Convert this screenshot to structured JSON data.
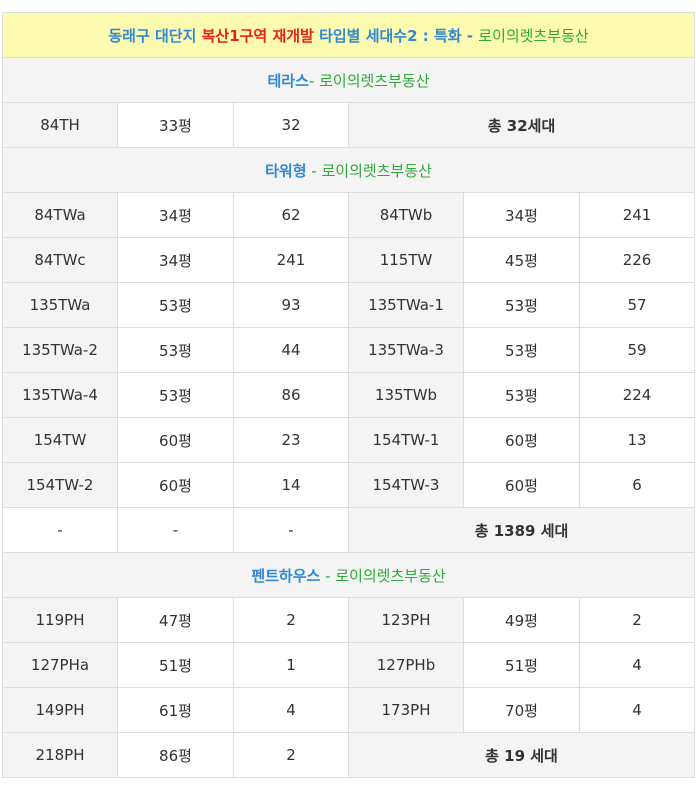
{
  "title": {
    "part1": "동래구 대단지 ",
    "part2": "복산1구역 재개발",
    "part3": " 타입별 세대수2 : 특화 - ",
    "part4": "로이의렛츠부동산"
  },
  "sections": {
    "terrace": {
      "name": "테라스",
      "sep": "- ",
      "brand": "로이의렛츠부동산"
    },
    "tower": {
      "name": "타워형",
      "sep": " - ",
      "brand": "로이의렛츠부동산"
    },
    "penthouse": {
      "name": "펜트하우스",
      "sep": " - ",
      "brand": "로이의렛츠부동산"
    }
  },
  "terrace_row": {
    "type": "84TH",
    "pyeong": "33평",
    "count": "32",
    "total": "총 32세대"
  },
  "tower_rows": [
    [
      {
        "type": "84TWa",
        "pyeong": "34평",
        "count": "62"
      },
      {
        "type": "84TWb",
        "pyeong": "34평",
        "count": "241"
      }
    ],
    [
      {
        "type": "84TWc",
        "pyeong": "34평",
        "count": "241"
      },
      {
        "type": "115TW",
        "pyeong": "45평",
        "count": "226"
      }
    ],
    [
      {
        "type": "135TWa",
        "pyeong": "53평",
        "count": "93"
      },
      {
        "type": "135TWa-1",
        "pyeong": "53평",
        "count": "57"
      }
    ],
    [
      {
        "type": "135TWa-2",
        "pyeong": "53평",
        "count": "44"
      },
      {
        "type": "135TWa-3",
        "pyeong": "53평",
        "count": "59"
      }
    ],
    [
      {
        "type": "135TWa-4",
        "pyeong": "53평",
        "count": "86"
      },
      {
        "type": "135TWb",
        "pyeong": "53평",
        "count": "224"
      }
    ],
    [
      {
        "type": "154TW",
        "pyeong": "60평",
        "count": "23"
      },
      {
        "type": "154TW-1",
        "pyeong": "60평",
        "count": "13"
      }
    ],
    [
      {
        "type": "154TW-2",
        "pyeong": "60평",
        "count": "14"
      },
      {
        "type": "154TW-3",
        "pyeong": "60평",
        "count": "6"
      }
    ]
  ],
  "tower_total": {
    "dash": "-",
    "total": "총 1389 세대"
  },
  "ph_rows": [
    [
      {
        "type": "119PH",
        "pyeong": "47평",
        "count": "2"
      },
      {
        "type": "123PH",
        "pyeong": "49평",
        "count": "2"
      }
    ],
    [
      {
        "type": "127PHa",
        "pyeong": "51평",
        "count": "1"
      },
      {
        "type": "127PHb",
        "pyeong": "51평",
        "count": "4"
      }
    ],
    [
      {
        "type": "149PH",
        "pyeong": "61평",
        "count": "4"
      },
      {
        "type": "173PH",
        "pyeong": "70평",
        "count": "4"
      }
    ]
  ],
  "ph_last": {
    "type": "218PH",
    "pyeong": "86평",
    "count": "2",
    "total": "총 19 세대"
  }
}
